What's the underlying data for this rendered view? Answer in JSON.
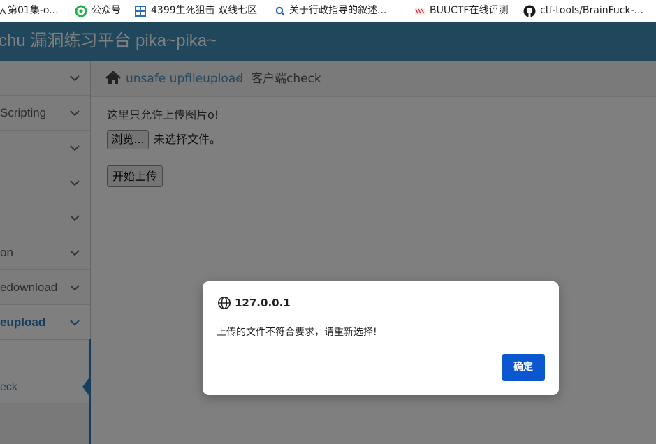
{
  "bookmarks": [
    {
      "label": "第01集-o...",
      "icon": "bookmark-icon"
    },
    {
      "label": "公众号",
      "icon": "wechat-icon"
    },
    {
      "label": "4399生死狙击 双线七区",
      "icon": "game-4399-icon"
    },
    {
      "label": "关于行政指导的叙述...",
      "icon": "search-icon"
    },
    {
      "label": "BUUCTF在线评测",
      "icon": "buuctf-icon"
    },
    {
      "label": "ctf-tools/BrainFuck-...",
      "icon": "github-icon"
    }
  ],
  "header": {
    "brand": "chu 漏洞练习平台 pika~pika~"
  },
  "sidebar": {
    "items": [
      {
        "label": ""
      },
      {
        "label": "Scripting"
      },
      {
        "label": ""
      },
      {
        "label": ""
      },
      {
        "label": ""
      },
      {
        "label": "on"
      },
      {
        "label": "edownload"
      },
      {
        "label": "eupload"
      }
    ],
    "sub_item": "eck"
  },
  "breadcrumb": {
    "parent": "unsafe upfileupload",
    "separator": "›",
    "current": "客户端check"
  },
  "content": {
    "hint": "这里只允许上传图片o!",
    "browse_label": "浏览...",
    "no_file_text": "未选择文件。",
    "upload_label": "开始上传"
  },
  "dialog": {
    "origin": "127.0.0.1",
    "message": "上传的文件不符合要求，请重新选择!",
    "ok_label": "确定"
  },
  "colors": {
    "header_bg": "#438eb9",
    "accent": "#2b7dbc",
    "dialog_button": "#0b57d0"
  }
}
